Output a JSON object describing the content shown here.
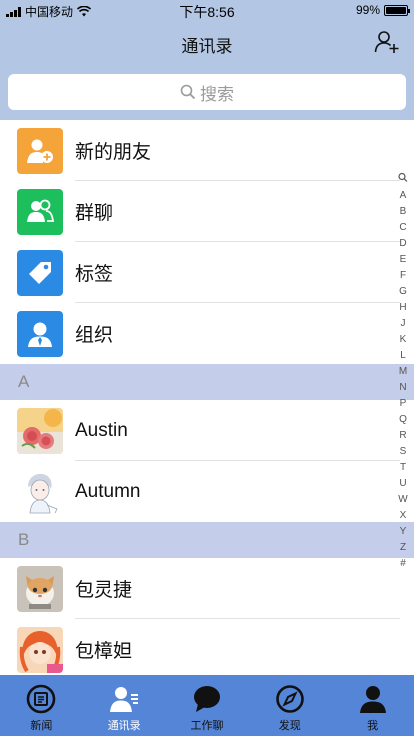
{
  "status_bar": {
    "carrier": "中国移动",
    "time": "下午8:56",
    "battery": "99%"
  },
  "nav": {
    "title": "通讯录"
  },
  "search": {
    "placeholder": "搜索"
  },
  "function_items": [
    {
      "label": "新的朋友",
      "icon": "add-friend-icon",
      "color": "#f5a43a"
    },
    {
      "label": "群聊",
      "icon": "group-chat-icon",
      "color": "#1dbf5c"
    },
    {
      "label": "标签",
      "icon": "tag-icon",
      "color": "#2b8ae4"
    },
    {
      "label": "组织",
      "icon": "organization-icon",
      "color": "#2b8ae4"
    }
  ],
  "sections": [
    {
      "letter": "A",
      "contacts": [
        {
          "name": "Austin"
        },
        {
          "name": "Autumn"
        }
      ]
    },
    {
      "letter": "B",
      "contacts": [
        {
          "name": "包灵捷"
        },
        {
          "name": "包樟妲"
        }
      ]
    }
  ],
  "index_letters": [
    "A",
    "B",
    "C",
    "D",
    "E",
    "F",
    "G",
    "H",
    "J",
    "K",
    "L",
    "M",
    "N",
    "P",
    "Q",
    "R",
    "S",
    "T",
    "U",
    "W",
    "X",
    "Y",
    "Z",
    "#"
  ],
  "tabs": [
    {
      "label": "新闻",
      "icon": "news-icon",
      "active": false
    },
    {
      "label": "通讯录",
      "icon": "contacts-icon",
      "active": true
    },
    {
      "label": "工作聊",
      "icon": "chat-bubble-icon",
      "active": false
    },
    {
      "label": "发现",
      "icon": "compass-icon",
      "active": false
    },
    {
      "label": "我",
      "icon": "person-icon",
      "active": false
    }
  ],
  "colors": {
    "header_bg": "#b3c6e4",
    "section_bg": "#c4cde9",
    "tabbar_bg": "#5585d6"
  }
}
